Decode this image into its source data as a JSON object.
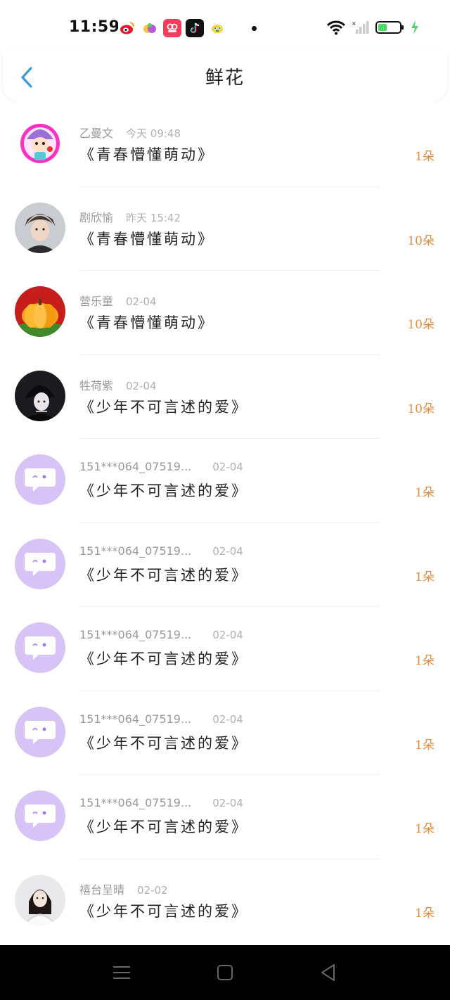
{
  "status_bar": {
    "time": "11:59",
    "app_icons": [
      "weibo-icon",
      "fruit-app-icon",
      "video-app-icon",
      "tiktok-icon",
      "bird-app-icon"
    ],
    "battery_color": "#4cd964"
  },
  "header": {
    "title": "鲜花",
    "back_icon": "chevron-left-icon",
    "accent": "#3a9bdc"
  },
  "records": [
    {
      "name": "乙曼文",
      "date": "今天 09:48",
      "book": "《青春懵懂萌动》",
      "count": "1朵",
      "avatar": "cartoon-girl-avatar"
    },
    {
      "name": "剧欣愉",
      "date": "昨天 15:42",
      "book": "《青春懵懂萌动》",
      "count": "10朵",
      "avatar": "boy-photo-avatar"
    },
    {
      "name": "营乐童",
      "date": "02-04",
      "book": "《青春懵懂萌动》",
      "count": "10朵",
      "avatar": "pumpkin-avatar"
    },
    {
      "name": "牲荷紫",
      "date": "02-04",
      "book": "《少年不可言述的爱》",
      "count": "10朵",
      "avatar": "anime-boy-avatar"
    },
    {
      "name": "151***064_07519...",
      "date": "02-04",
      "book": "《少年不可言述的爱》",
      "count": "1朵",
      "avatar": "default-chat-avatar"
    },
    {
      "name": "151***064_07519...",
      "date": "02-04",
      "book": "《少年不可言述的爱》",
      "count": "1朵",
      "avatar": "default-chat-avatar"
    },
    {
      "name": "151***064_07519...",
      "date": "02-04",
      "book": "《少年不可言述的爱》",
      "count": "1朵",
      "avatar": "default-chat-avatar"
    },
    {
      "name": "151***064_07519...",
      "date": "02-04",
      "book": "《少年不可言述的爱》",
      "count": "1朵",
      "avatar": "default-chat-avatar"
    },
    {
      "name": "151***064_07519...",
      "date": "02-04",
      "book": "《少年不可言述的爱》",
      "count": "1朵",
      "avatar": "default-chat-avatar"
    },
    {
      "name": "禧台呈晴",
      "date": "02-02",
      "book": "《少年不可言述的爱》",
      "count": "1朵",
      "avatar": "woman-photo-avatar"
    }
  ],
  "colors": {
    "count": "#e58a3a",
    "name": "#9a9a9a",
    "default_avatar_bg": "#d7c3f5"
  },
  "nav_bar": {
    "buttons": [
      "menu-icon",
      "home-square-icon",
      "back-triangle-icon"
    ]
  }
}
